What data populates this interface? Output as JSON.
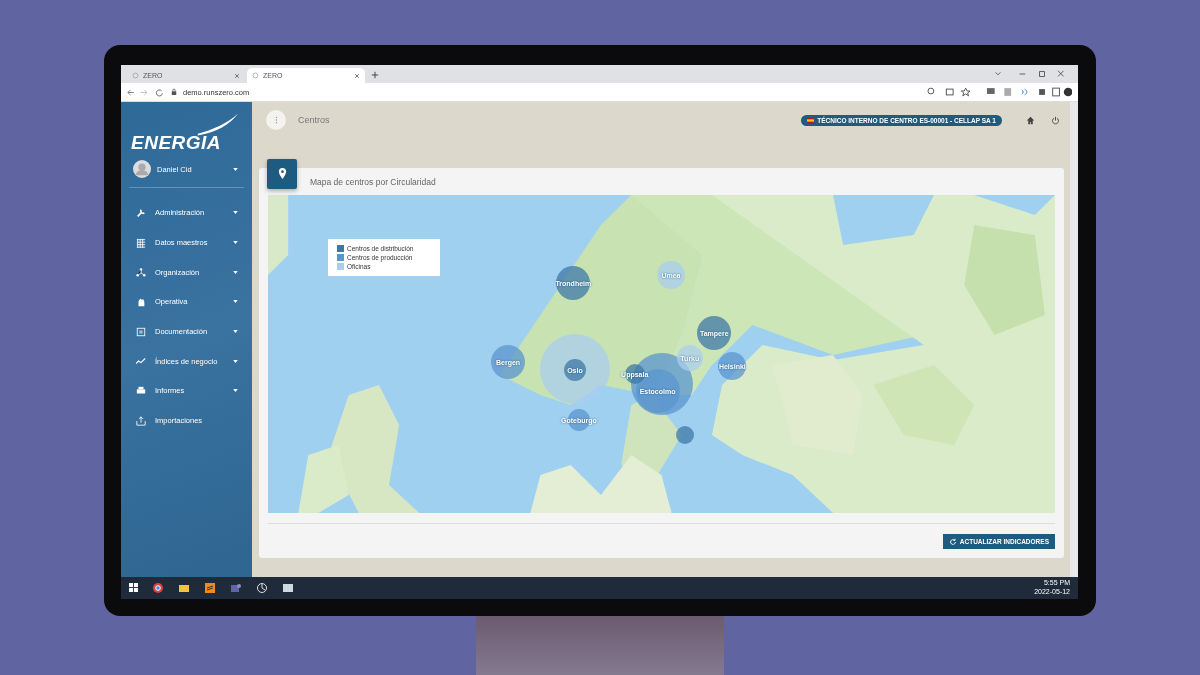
{
  "browser": {
    "tabs": [
      {
        "label": "ZERO",
        "selected": false
      },
      {
        "label": "ZERO",
        "selected": true
      }
    ],
    "url": "demo.runszero.com"
  },
  "sidebar": {
    "logo": "ENERGIA",
    "user": "Daniel Cid",
    "items": [
      {
        "label": "Administración",
        "expandable": true
      },
      {
        "label": "Datos maestros",
        "expandable": true
      },
      {
        "label": "Organización",
        "expandable": true
      },
      {
        "label": "Operativa",
        "expandable": true
      },
      {
        "label": "Documentación",
        "expandable": true
      },
      {
        "label": "Índices de negocio",
        "expandable": true
      },
      {
        "label": "Informes",
        "expandable": true
      },
      {
        "label": "Importaciones",
        "expandable": false
      }
    ]
  },
  "topbar": {
    "title": "Centros",
    "role_badge": "TÉCNICO INTERNO DE CENTRO ES-00001 - CELLAP SA 1"
  },
  "card": {
    "title": "Mapa de centros por Circularidad",
    "legend": [
      {
        "label": "Centros de distribución",
        "kind": "distribution",
        "color": "#3f78a8"
      },
      {
        "label": "Centros de producción",
        "kind": "production",
        "color": "#5b95cf"
      },
      {
        "label": "Oficinas",
        "kind": "office",
        "color": "#a9cdee"
      }
    ],
    "markers": [
      {
        "name": "Trondheim",
        "kind": "distribution"
      },
      {
        "name": "Umea",
        "kind": "office"
      },
      {
        "name": "Bergen",
        "kind": "production"
      },
      {
        "kind": "office"
      },
      {
        "name": "Oslo",
        "kind": "distribution"
      },
      {
        "name": "Goteburgo",
        "kind": "production"
      },
      {
        "kind": "production"
      },
      {
        "name": "Estocolmo",
        "kind": "production"
      },
      {
        "name": "Uppsala",
        "kind": "distribution"
      },
      {
        "name": "Turku",
        "kind": "office"
      },
      {
        "name": "Tampere",
        "kind": "distribution"
      },
      {
        "name": "Helsinki",
        "kind": "production"
      },
      {
        "kind": "distribution"
      }
    ],
    "button": "ACTUALIZAR INDICADORES"
  },
  "taskbar": {
    "time": "5:55 PM",
    "date": "2022-05-12"
  }
}
